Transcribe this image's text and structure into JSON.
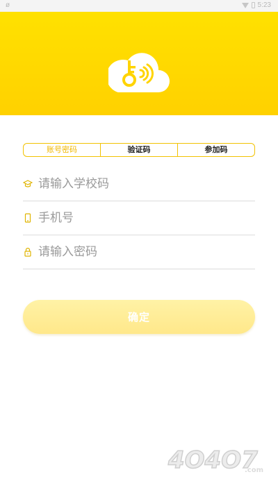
{
  "status_bar": {
    "left_icon": "ø",
    "time": "5:23"
  },
  "header": {
    "logo_icon": "cloud-key-icon",
    "bg_color": "#FFD800"
  },
  "tabs": [
    {
      "label": "账号密码",
      "active": true
    },
    {
      "label": "验证码",
      "active": false
    },
    {
      "label": "参加码",
      "active": false
    }
  ],
  "fields": {
    "school": {
      "placeholder": "请输入学校码",
      "icon": "graduation-cap-icon"
    },
    "phone": {
      "placeholder": "手机号",
      "icon": "phone-icon"
    },
    "password": {
      "placeholder": "请输入密码",
      "icon": "lock-icon"
    }
  },
  "confirm_label": "确定",
  "watermark_text": "4O4O7.com",
  "accent_color": "#F1B800"
}
